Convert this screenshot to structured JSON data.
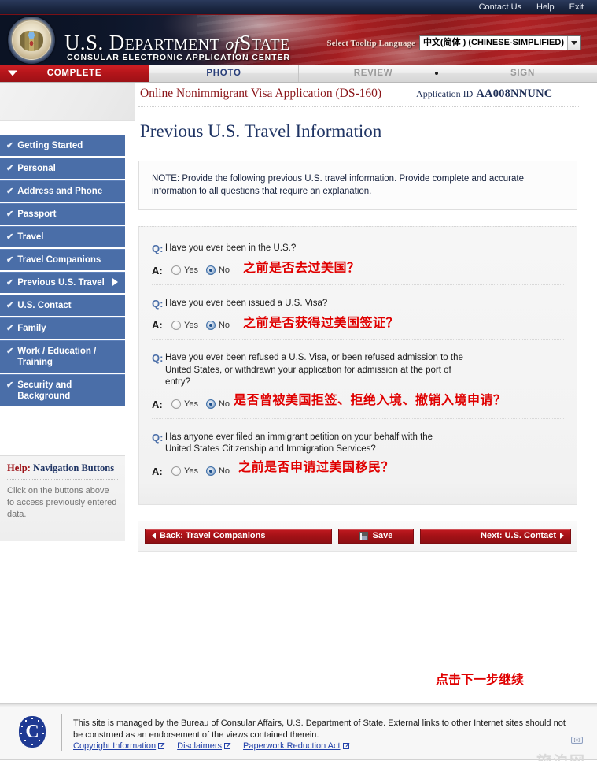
{
  "topbar": {
    "links": [
      "Contact Us",
      "Help",
      "Exit"
    ]
  },
  "banner": {
    "title_us": "U.S. D",
    "title_epartment": "EPARTMENT",
    "title_of": "of",
    "title_s": "S",
    "title_tate": "TATE",
    "subtitle": "CONSULAR ELECTRONIC APPLICATION CENTER",
    "language_label": "Select Tooltip Language",
    "language_value": "中文(简体 ) (CHINESE-SIMPLIFIED)"
  },
  "steps": [
    {
      "label": "COMPLETE",
      "state": "active"
    },
    {
      "label": "PHOTO",
      "state": "available"
    },
    {
      "label": "REVIEW",
      "state": "disabled"
    },
    {
      "label": "SIGN",
      "state": "disabled"
    }
  ],
  "sidebar": {
    "items": [
      {
        "label": "Getting Started",
        "check": "✔",
        "current": false
      },
      {
        "label": "Personal",
        "check": "✔",
        "current": false
      },
      {
        "label": "Address and Phone",
        "check": "✔",
        "current": false
      },
      {
        "label": "Passport",
        "check": "✔",
        "current": false
      },
      {
        "label": "Travel",
        "check": "✔",
        "current": false
      },
      {
        "label": "Travel Companions",
        "check": "✔",
        "current": false
      },
      {
        "label": "Previous U.S. Travel",
        "check": "✔",
        "current": true
      },
      {
        "label": "U.S. Contact",
        "check": "✔",
        "current": false
      },
      {
        "label": "Family",
        "check": "✔",
        "current": false
      },
      {
        "label": "Work / Education / Training",
        "check": "✔",
        "current": false
      },
      {
        "label": "Security and Background",
        "check": "✔",
        "current": false
      }
    ],
    "help": {
      "title_highlight": "Help:",
      "title_rest": " Navigation Buttons",
      "body": "Click on the buttons above to access previously entered data."
    }
  },
  "header": {
    "app_title": "Online Nonimmigrant Visa Application (DS-160)",
    "app_id_label": "Application ID",
    "app_id_value": "AA008NNUNC",
    "page_title": "Previous U.S. Travel Information"
  },
  "note": {
    "text": "NOTE: Provide the following previous U.S. travel information. Provide complete and accurate information to all questions that require an explanation."
  },
  "questions": [
    {
      "q_letter": "Q:",
      "a_letter": "A:",
      "question": "Have you ever been in the U.S.?",
      "annotation": "之前是否去过美国？",
      "options": [
        {
          "label": "Yes",
          "checked": false
        },
        {
          "label": "No",
          "checked": true
        }
      ]
    },
    {
      "q_letter": "Q:",
      "a_letter": "A:",
      "question": "Have you ever been issued a U.S. Visa?",
      "annotation": "之前是否获得过美国签证？",
      "options": [
        {
          "label": "Yes",
          "checked": false
        },
        {
          "label": "No",
          "checked": true
        }
      ]
    },
    {
      "q_letter": "Q:",
      "a_letter": "A:",
      "question": "Have you ever been refused a U.S. Visa, or been refused admission to the United States, or withdrawn your application for admission at the port of entry?",
      "annotation": "是否曾被美国拒签、拒绝入境、撤销入境申请？",
      "options": [
        {
          "label": "Yes",
          "checked": false
        },
        {
          "label": "No",
          "checked": true
        }
      ]
    },
    {
      "q_letter": "Q:",
      "a_letter": "A:",
      "question": "Has anyone ever filed an immigrant petition on your behalf with the United States Citizenship and Immigration Services?",
      "annotation": "之前是否申请过美国移民？",
      "options": [
        {
          "label": "Yes",
          "checked": false
        },
        {
          "label": "No",
          "checked": true
        }
      ]
    }
  ],
  "buttons": {
    "back": "Back: Travel Companions",
    "save": "Save",
    "next": "Next: U.S. Contact",
    "next_annotation": "点击下一步继续"
  },
  "footer": {
    "logo_letter": "C",
    "text": "This site is managed by the Bureau of Consular Affairs, U.S. Department of State. External links to other Internet sites should not be construed as an endorsement of the views contained therein.",
    "links": [
      "Copyright Information",
      "Disclaimers",
      "Paperwork Reduction Act"
    ],
    "badge": "[::]",
    "watermark": "旅泊网"
  },
  "colors": {
    "accent_red": "#9c1116",
    "nav_blue": "#4a6ea8",
    "title_blue": "#1f3464",
    "annotation_red": "#e00000"
  }
}
